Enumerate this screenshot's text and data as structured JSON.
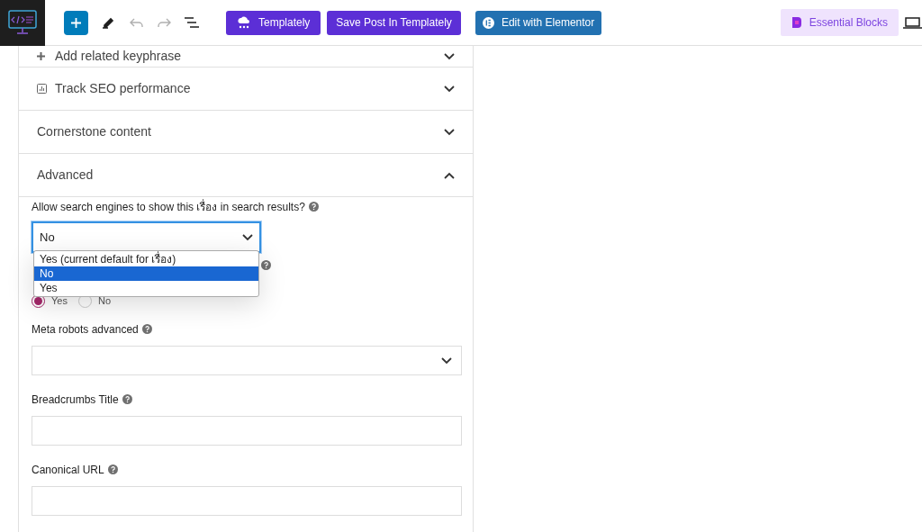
{
  "toolbar": {
    "templately": "Templately",
    "save": "Save Post In Templately",
    "elementor": "Edit with Elementor",
    "essential": "Essential Blocks"
  },
  "sections": [
    {
      "label": "Add related keyphrase",
      "kind": "plus",
      "expanded": false
    },
    {
      "label": "Track SEO performance",
      "kind": "chart",
      "expanded": false
    },
    {
      "label": "Cornerstone content",
      "kind": "plain",
      "expanded": false
    },
    {
      "label": "Advanced",
      "kind": "plain",
      "expanded": true
    }
  ],
  "advanced": {
    "search_label": "Allow search engines to show this เรื่อง in search results?",
    "search_value": "No",
    "dropdown_open": true,
    "options": [
      {
        "label": "Yes (current default for เรื่อง)",
        "selected": false
      },
      {
        "label": "No",
        "selected": true
      },
      {
        "label": "Yes",
        "selected": false
      }
    ],
    "radios": [
      {
        "label": "Yes",
        "selected": true
      },
      {
        "label": "No",
        "selected": false
      }
    ],
    "meta_label": "Meta robots advanced",
    "breadcrumbs_label": "Breadcrumbs Title",
    "canonical_label": "Canonical URL"
  }
}
